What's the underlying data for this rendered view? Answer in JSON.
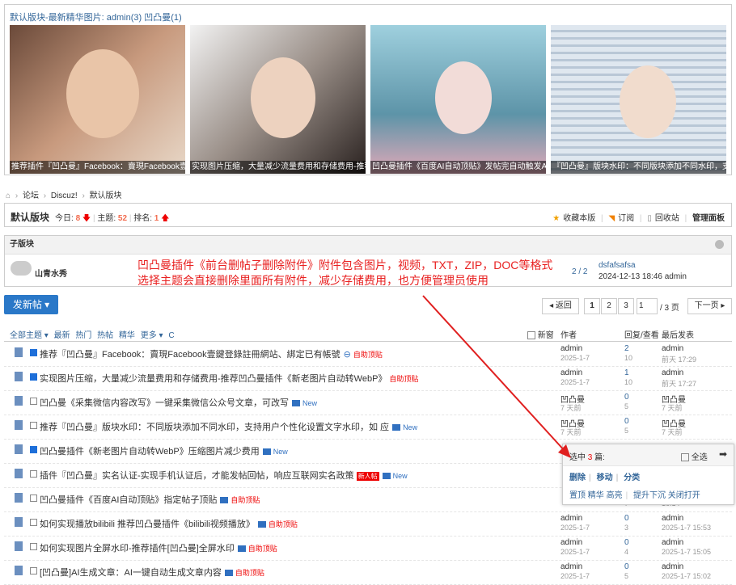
{
  "gallery": {
    "heading": "默认版块-最新精华图片: admin(3) 凹凸曼(1)",
    "items": [
      {
        "caption": "推荐插件『凹凸曼』Facebook：賣現Facebook壹鍵登",
        "bg": "#c89a7e"
      },
      {
        "caption": "实现图片压缩，大量减少流量费用和存储费用-推荐凹",
        "bg": "#9a8f88"
      },
      {
        "caption": "凹凸曼插件《百度AI自动顶贴》发帖完自动触发AI自",
        "bg": "#5d94a8"
      },
      {
        "caption": "『凹凸曼』版块水印：不同版块添加不同水印，支持",
        "bg": "#b9c7d6"
      }
    ]
  },
  "breadcrumb": {
    "home_icon": "home-icon",
    "items": [
      "论坛",
      "Discuz!",
      "默认版块"
    ]
  },
  "forum": {
    "title": "默认版块",
    "today_label": "今日:",
    "today_value": "8",
    "topics_label": "主题:",
    "topics_value": "52",
    "rank_label": "排名:",
    "rank_value": "1",
    "actions": [
      "收藏本版",
      "订阅",
      "回收站",
      "管理面板"
    ]
  },
  "subforum": {
    "header": "子版块",
    "name": "山青水秀",
    "count": "2 / 2",
    "last_title": "dsfafsafsa",
    "last_meta": "2024-12-13 18:46 admin"
  },
  "annotation": {
    "line1": "凹凸曼插件《前台删帖子删除附件》附件包含图片，视频，TXT，ZIP，DOC等格式",
    "line2": "选择主题会直接删除里面所有附件，减少存储费用，也方便管理员使用"
  },
  "post_button": "发新帖 ▾",
  "pager": {
    "back": "◂ 返回",
    "pages": [
      "1",
      "2",
      "3"
    ],
    "input_value": "1",
    "total": "/ 3 页",
    "next": "下一页 ▸"
  },
  "thread_bar": {
    "filters": [
      "全部主题 ▾",
      "最新",
      "热门",
      "热帖",
      "精华",
      "更多 ▾",
      "C"
    ],
    "new_window": "新窗",
    "col_author": "作者",
    "col_replies": "回复/查看",
    "col_last": "最后发表"
  },
  "threads": [
    {
      "checked": true,
      "title": "推荐『凹凸曼』Facebook：賣現Facebook壹鍵登錄註冊網站、綁定已有帳號",
      "tag": "自助顶贴",
      "icon": "link",
      "author": "admin",
      "date": "2025-1-7",
      "replies": "2",
      "views": "10",
      "last_user": "admin",
      "last_time": "前天 17:29"
    },
    {
      "checked": true,
      "title": "实现图片压缩，大量减少流量费用和存储费用-推荐凹凸曼插件《新老图片自动转WebP》",
      "tag": "自助顶贴",
      "icon": "",
      "author": "admin",
      "date": "2025-1-7",
      "replies": "1",
      "views": "10",
      "last_user": "admin",
      "last_time": "前天 17:27"
    },
    {
      "checked": false,
      "title": "凹凸曼《采集微信内容改写》一键采集微信公众号文章，可改写",
      "tag": "New",
      "icon": "img",
      "author": "凹凸曼",
      "date": "7 天前",
      "replies": "0",
      "views": "5",
      "last_user": "凹凸曼",
      "last_time": "7 天前"
    },
    {
      "checked": false,
      "title": "推荐『凹凸曼』版块水印：不同版块添加不同水印，支持用户个性化设置文字水印，如 应",
      "tag": "New",
      "icon": "img",
      "author": "凹凸曼",
      "date": "7 天前",
      "replies": "0",
      "views": "5",
      "last_user": "凹凸曼",
      "last_time": "7 天前"
    },
    {
      "checked": true,
      "title": "凹凸曼插件《新老图片自动转WebP》压缩图片减少费用",
      "tag": "New",
      "icon": "img",
      "author": "",
      "date": "",
      "replies": "",
      "views": "",
      "last_user": "",
      "last_time": ""
    },
    {
      "checked": false,
      "title": "插件『凹凸曼』实名认证-实现手机认证后，才能发帖回帖，响应互联网实名政策",
      "tag": "New",
      "icon": "newimg",
      "author": "",
      "date": "",
      "replies": "",
      "views": "",
      "last_user": "",
      "last_time": ""
    },
    {
      "checked": false,
      "title": "凹凸曼插件《百度AI自动顶贴》指定帖子顶贴",
      "tag": "自助顶贴",
      "icon": "img",
      "author": "",
      "date": "",
      "replies": "",
      "views": "7",
      "last_user": "",
      "last_time": "16:14"
    },
    {
      "checked": false,
      "title": "如何实现播放bilibili 推荐凹凸曼插件《bilibili视频播放》",
      "tag": "自助顶贴",
      "icon": "img",
      "author": "admin",
      "date": "2025-1-7",
      "replies": "0",
      "views": "3",
      "last_user": "admin",
      "last_time": "2025-1-7 15:53"
    },
    {
      "checked": false,
      "title": "如何实现图片全屏水印-推荐插件[凹凸曼]全屏水印",
      "tag": "自助顶贴",
      "icon": "img",
      "author": "admin",
      "date": "2025-1-7",
      "replies": "0",
      "views": "4",
      "last_user": "admin",
      "last_time": "2025-1-7 15:05"
    },
    {
      "checked": false,
      "title": "[凹凸曼]AI生成文章：AI一键自动生成文章内容",
      "tag": "自助顶贴",
      "icon": "img",
      "author": "admin",
      "date": "2025-1-7",
      "replies": "0",
      "views": "5",
      "last_user": "admin",
      "last_time": "2025-1-7 15:02"
    }
  ],
  "popup": {
    "selected_label": "选中",
    "selected_count": "3",
    "selected_unit": "篇:",
    "select_all": "全选",
    "actions_primary": [
      "删除",
      "移动",
      "分类"
    ],
    "actions_secondary": [
      "置顶",
      "精华",
      "高亮",
      "提升下沉",
      "关闭打开"
    ]
  }
}
